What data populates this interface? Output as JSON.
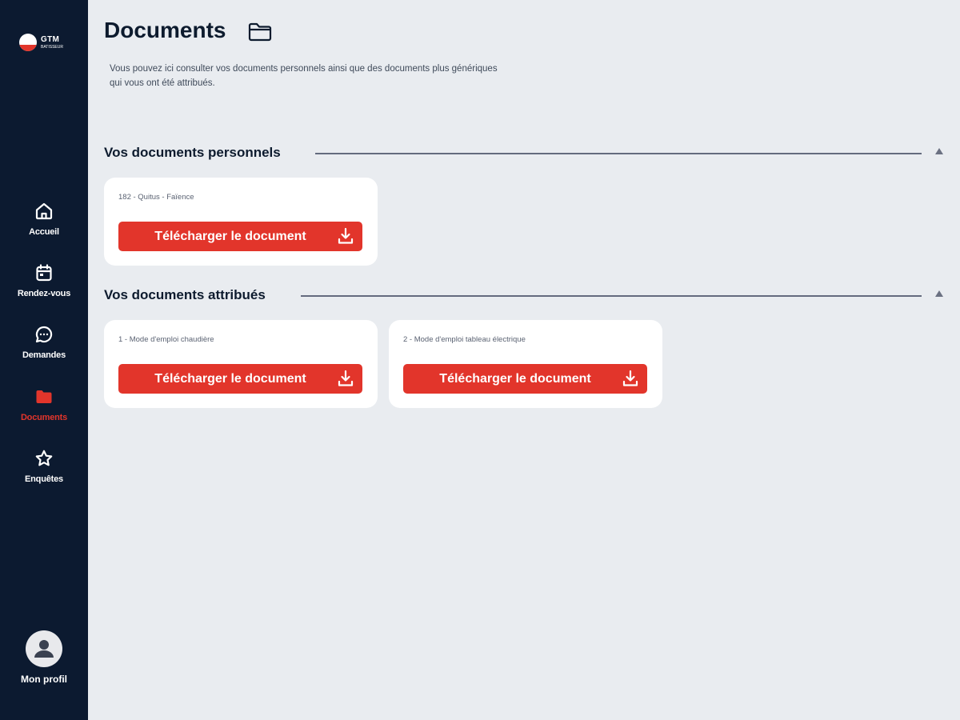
{
  "sidebar": {
    "logo": {
      "text": "GTM",
      "subtext": "BATISSEUR"
    },
    "items": [
      {
        "label": "Accueil",
        "icon": "home-icon"
      },
      {
        "label": "Rendez-vous",
        "icon": "calendar-icon"
      },
      {
        "label": "Demandes",
        "icon": "chat-bubble-icon"
      },
      {
        "label": "Documents",
        "icon": "folder-icon",
        "active": true
      },
      {
        "label": "Enquêtes",
        "icon": "star-icon"
      }
    ],
    "profile": {
      "label": "Mon profil",
      "icon": "user-avatar-icon"
    }
  },
  "header": {
    "title": "Documents",
    "title_icon": "folder-outline-icon",
    "intro_line1": "Vous pouvez ici consulter vos documents personnels ainsi que des documents plus génériques",
    "intro_line2": "qui vous ont été attribués."
  },
  "sections": [
    {
      "title": "Vos documents personnels",
      "collapse_icon": "triangle-up-icon",
      "documents": [
        {
          "name": "182 - Quitus - Faïence",
          "button_label": "Télécharger le document",
          "icon": "download-icon"
        }
      ]
    },
    {
      "title": "Vos documents attribués",
      "collapse_icon": "triangle-up-icon",
      "documents": [
        {
          "name": "1 - Mode d'emploi chaudière",
          "button_label": "Télécharger le document",
          "icon": "download-icon"
        },
        {
          "name": "2 - Mode d'emploi tableau électrique",
          "button_label": "Télécharger le document",
          "icon": "download-icon"
        }
      ]
    }
  ],
  "colors": {
    "sidebar_bg": "#0c1a30",
    "page_bg": "#e9ecf0",
    "accent": "#e2352b",
    "card_bg": "#ffffff",
    "text_dark": "#0d1b2e"
  }
}
